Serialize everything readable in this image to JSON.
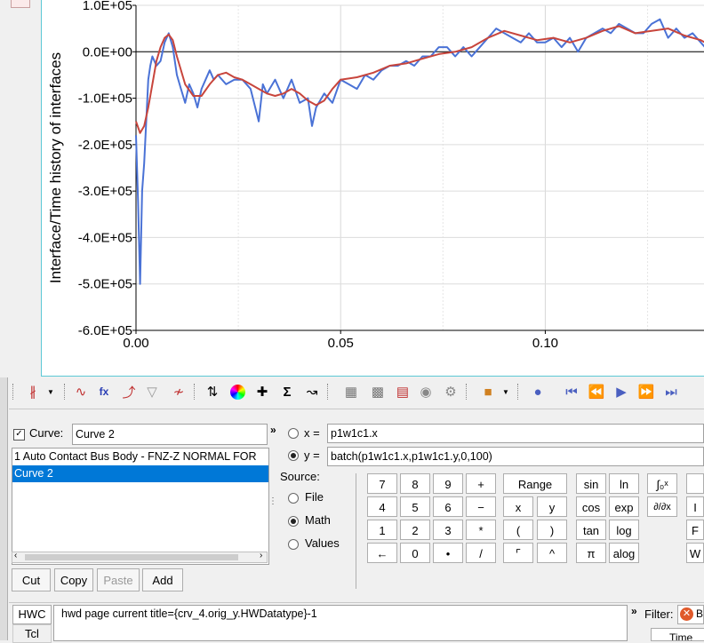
{
  "chart_data": {
    "type": "line",
    "ylabel": "Interface/Time history of interfaces",
    "xlabel": "",
    "xlim": [
      0.0,
      0.139
    ],
    "ylim": [
      -600000,
      100000
    ],
    "xticks": [
      "0.00",
      "0.05",
      "0.10"
    ],
    "yticks": [
      "1.0E+05",
      "0.0E+00",
      "-1.0E+05",
      "-2.0E+05",
      "-3.0E+05",
      "-4.0E+05",
      "-5.0E+05",
      "-6.0E+05"
    ],
    "grid": true,
    "series": [
      {
        "name": "1 Auto Contact Bus Body - FNZ-Z NORMAL FOR",
        "color": "#4a72d6",
        "x": [
          0.0,
          0.0005,
          0.001,
          0.0015,
          0.002,
          0.0025,
          0.003,
          0.0035,
          0.004,
          0.005,
          0.006,
          0.007,
          0.008,
          0.009,
          0.01,
          0.011,
          0.012,
          0.013,
          0.014,
          0.015,
          0.016,
          0.017,
          0.018,
          0.019,
          0.02,
          0.022,
          0.024,
          0.026,
          0.028,
          0.03,
          0.031,
          0.032,
          0.034,
          0.036,
          0.038,
          0.04,
          0.042,
          0.043,
          0.044,
          0.046,
          0.048,
          0.05,
          0.052,
          0.054,
          0.056,
          0.058,
          0.06,
          0.062,
          0.064,
          0.066,
          0.068,
          0.07,
          0.072,
          0.074,
          0.076,
          0.078,
          0.08,
          0.082,
          0.084,
          0.086,
          0.088,
          0.09,
          0.092,
          0.094,
          0.096,
          0.098,
          0.1,
          0.102,
          0.104,
          0.106,
          0.108,
          0.11,
          0.112,
          0.114,
          0.116,
          0.118,
          0.12,
          0.122,
          0.124,
          0.126,
          0.128,
          0.13,
          0.132,
          0.134,
          0.136,
          0.138,
          0.139
        ],
        "y": [
          -180000,
          -320000,
          -500000,
          -300000,
          -240000,
          -150000,
          -60000,
          -30000,
          -10000,
          -30000,
          -20000,
          20000,
          40000,
          10000,
          -50000,
          -80000,
          -110000,
          -70000,
          -90000,
          -120000,
          -80000,
          -60000,
          -40000,
          -60000,
          -50000,
          -70000,
          -60000,
          -60000,
          -80000,
          -150000,
          -70000,
          -90000,
          -60000,
          -100000,
          -60000,
          -110000,
          -100000,
          -160000,
          -120000,
          -90000,
          -110000,
          -60000,
          -70000,
          -80000,
          -50000,
          -60000,
          -40000,
          -30000,
          -30000,
          -20000,
          -30000,
          -10000,
          -10000,
          10000,
          10000,
          -10000,
          10000,
          -10000,
          10000,
          30000,
          50000,
          40000,
          30000,
          20000,
          40000,
          20000,
          20000,
          30000,
          10000,
          30000,
          0,
          30000,
          40000,
          50000,
          40000,
          60000,
          50000,
          40000,
          40000,
          60000,
          70000,
          30000,
          50000,
          30000,
          40000,
          20000,
          10000
        ]
      },
      {
        "name": "Curve 2",
        "color": "#c8453c",
        "x": [
          0.0,
          0.001,
          0.002,
          0.003,
          0.004,
          0.005,
          0.006,
          0.007,
          0.008,
          0.009,
          0.01,
          0.012,
          0.014,
          0.016,
          0.018,
          0.02,
          0.022,
          0.024,
          0.026,
          0.028,
          0.03,
          0.032,
          0.034,
          0.036,
          0.038,
          0.04,
          0.042,
          0.044,
          0.046,
          0.048,
          0.05,
          0.054,
          0.058,
          0.062,
          0.066,
          0.07,
          0.074,
          0.078,
          0.082,
          0.086,
          0.09,
          0.094,
          0.098,
          0.102,
          0.106,
          0.11,
          0.114,
          0.118,
          0.122,
          0.126,
          0.13,
          0.134,
          0.138,
          0.139
        ],
        "y": [
          -150000,
          -175000,
          -160000,
          -120000,
          -70000,
          -20000,
          10000,
          30000,
          37000,
          25000,
          -10000,
          -70000,
          -95000,
          -95000,
          -70000,
          -50000,
          -45000,
          -55000,
          -60000,
          -70000,
          -80000,
          -90000,
          -95000,
          -90000,
          -80000,
          -90000,
          -105000,
          -115000,
          -105000,
          -80000,
          -60000,
          -55000,
          -45000,
          -30000,
          -25000,
          -15000,
          -5000,
          0,
          10000,
          30000,
          45000,
          35000,
          25000,
          30000,
          20000,
          30000,
          45000,
          55000,
          40000,
          45000,
          50000,
          35000,
          25000,
          20000
        ]
      }
    ]
  },
  "toolbar": {
    "icons": [
      "curve-type-icon",
      "plot-dropdown-icon",
      "curve-editor-icon",
      "define-curve-fx-icon",
      "add-curve-icon",
      "filter-icon",
      "delete-curve-icon",
      "peak-marker-icon",
      "color-wheel-icon",
      "crosshair-icon",
      "sigma-icon",
      "vector-icon",
      "grid-icon",
      "table-icon",
      "page-icon",
      "annotation-icon",
      "settings-gear-icon",
      "palette-icon",
      "palette-dropdown-icon",
      "play-mode-icon",
      "first-frame-icon",
      "prev-frame-icon",
      "play-icon",
      "next-frame-icon",
      "last-frame-icon"
    ]
  },
  "panel": {
    "curve_label": "Curve:",
    "curve_name": "Curve 2",
    "curve_checked": true,
    "expand_glyph": "»",
    "list_items": [
      "1 Auto Contact Bus Body - FNZ-Z NORMAL FOR",
      "Curve 2"
    ],
    "selected_index": 1,
    "x_label": "x =",
    "x_value": "p1w1c1.x",
    "y_label": "y =",
    "y_value": "batch(p1w1c1.x,p1w1c1.y,0,100)",
    "source_label": "Source:",
    "source_options": [
      "File",
      "Math",
      "Values"
    ],
    "source_selected": "Math",
    "buttons": [
      "Cut",
      "Copy",
      "Paste",
      "Add"
    ],
    "disabled_button": "Paste",
    "calc_keys": [
      "7",
      "8",
      "9",
      "+",
      "4",
      "5",
      "6",
      "−",
      "1",
      "2",
      "3",
      "*",
      "←",
      "0",
      "•",
      "/"
    ],
    "range_label": "Range",
    "xy_keys": [
      "x",
      "y",
      "(",
      ")",
      "⌜",
      "^"
    ],
    "func_keys": [
      "sin",
      "ln",
      "cos",
      "exp",
      "tan",
      "log",
      "π",
      "alog"
    ],
    "integral_glyph": "∫₀ˣ",
    "derivative_glyph": "∂/∂x",
    "side_keys": [
      "",
      "I",
      "F",
      "W"
    ]
  },
  "command": {
    "tab_hwc": "HWC",
    "tab_tcl": "Tcl",
    "command_text": "hwd page current title={crv_4.orig_y.HWDatatype}-1",
    "expand_glyph": "»",
    "filter_label": "Filter:",
    "filter_badge": "B",
    "column_header": "Time"
  }
}
